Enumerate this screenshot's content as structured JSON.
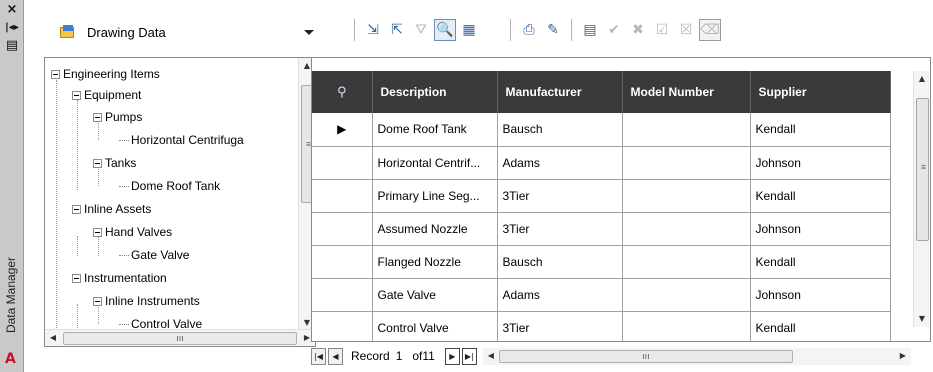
{
  "palette": {
    "title_strip": "#c9c9c9",
    "header_bg": "#3a3a3a",
    "logo": "#c8102e"
  },
  "strip": {
    "close_icon": "×",
    "pin_icon": "|◂▸",
    "properties_icon": "▤",
    "title": "Data Manager",
    "logo_text": "A"
  },
  "toolbar": {
    "dropdown_label": "Drawing Data",
    "icons_group1": [
      "export-icon",
      "import-icon",
      "filter-icon",
      "zoom-to-icon",
      "data-view-icon"
    ],
    "icons_group2": [
      "print-icon",
      "edit-icon",
      "grid-icon",
      "accept-icon",
      "reject-icon",
      "accept-all-icon",
      "reject-all-icon",
      "clear-icon"
    ]
  },
  "tree": {
    "nodes": [
      {
        "label": "Engineering Items",
        "level": 0,
        "expandable": true
      },
      {
        "label": "Equipment",
        "level": 1,
        "expandable": true
      },
      {
        "label": "Pumps",
        "level": 2,
        "expandable": true
      },
      {
        "label": "Horizontal Centrifuga",
        "level": 3,
        "expandable": false
      },
      {
        "label": "Tanks",
        "level": 2,
        "expandable": true
      },
      {
        "label": "Dome Roof Tank",
        "level": 3,
        "expandable": false
      },
      {
        "label": "Inline Assets",
        "level": 1,
        "expandable": true
      },
      {
        "label": "Hand Valves",
        "level": 2,
        "expandable": true
      },
      {
        "label": "Gate Valve",
        "level": 3,
        "expandable": false
      },
      {
        "label": "Instrumentation",
        "level": 1,
        "expandable": true
      },
      {
        "label": "Inline Instruments",
        "level": 2,
        "expandable": true
      },
      {
        "label": "Control Valve",
        "level": 3,
        "expandable": false
      }
    ]
  },
  "grid": {
    "columns": [
      "",
      "Description",
      "Manufacturer",
      "Model Number",
      "Supplier"
    ],
    "rows": [
      {
        "marker": "▶",
        "description": "Dome Roof Tank",
        "manufacturer": "Bausch",
        "model": "",
        "supplier": "Kendall"
      },
      {
        "marker": "",
        "description": "Horizontal Centrif...",
        "manufacturer": "Adams",
        "model": "",
        "supplier": "Johnson"
      },
      {
        "marker": "",
        "description": "Primary Line Seg...",
        "manufacturer": "3Tier",
        "model": "",
        "supplier": "Kendall"
      },
      {
        "marker": "",
        "description": "Assumed Nozzle",
        "manufacturer": "3Tier",
        "model": "",
        "supplier": "Johnson"
      },
      {
        "marker": "",
        "description": "Flanged Nozzle",
        "manufacturer": "Bausch",
        "model": "",
        "supplier": "Kendall"
      },
      {
        "marker": "",
        "description": "Gate Valve",
        "manufacturer": "Adams",
        "model": "",
        "supplier": "Johnson"
      },
      {
        "marker": "",
        "description": "Control Valve",
        "manufacturer": "3Tier",
        "model": "",
        "supplier": "Kendall"
      }
    ]
  },
  "navigator": {
    "record_label": "Record",
    "position": "1",
    "of_total": "of11"
  }
}
